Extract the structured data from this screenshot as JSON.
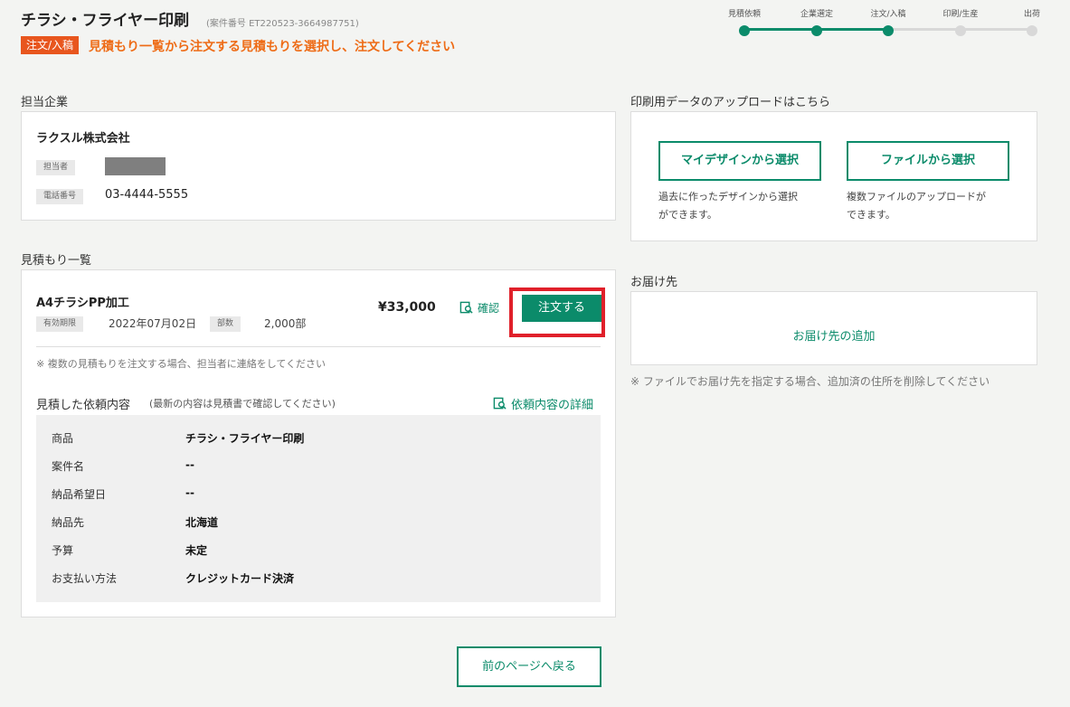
{
  "header": {
    "title": "チラシ・フライヤー印刷",
    "case_number": "(案件番号 ET220523-3664987751)",
    "status_badge": "注文/入稿",
    "instruction": "見積もり一覧から注文する見積もりを選択し、注文してください"
  },
  "stepper": {
    "steps": [
      {
        "label": "見積依頼",
        "state": "done"
      },
      {
        "label": "企業選定",
        "state": "done"
      },
      {
        "label": "注文/入稿",
        "state": "done"
      },
      {
        "label": "印刷/生産",
        "state": "todo"
      },
      {
        "label": "出荷",
        "state": "todo"
      }
    ]
  },
  "company": {
    "section_label": "担当企業",
    "name": "ラクスル株式会社",
    "contact_tag": "担当者",
    "phone_tag": "電話番号",
    "phone": "03-4444-5555"
  },
  "quotes": {
    "section_label": "見積もり一覧",
    "item": {
      "title": "A4チラシPP加工",
      "expiry_tag": "有効期限",
      "expiry": "2022年07月02日",
      "qty_tag": "部数",
      "qty": "2,000部",
      "price": "¥33,000",
      "confirm_label": "確認",
      "order_label": "注文する"
    },
    "multi_note": "※ 複数の見積もりを注文する場合、担当者に連絡をしてください",
    "request_heading": "見積した依頼内容",
    "request_note": "(最新の内容は見積書で確認してください)",
    "request_detail_link": "依頼内容の詳細",
    "details": [
      {
        "key": "商品",
        "value": "チラシ・フライヤー印刷"
      },
      {
        "key": "案件名",
        "value": "--"
      },
      {
        "key": "納品希望日",
        "value": "--"
      },
      {
        "key": "納品先",
        "value": "北海道"
      },
      {
        "key": "予算",
        "value": "未定"
      },
      {
        "key": "お支払い方法",
        "value": "クレジットカード決済"
      }
    ]
  },
  "upload": {
    "section_label": "印刷用データのアップロードはこちら",
    "design_button": "マイデザインから選択",
    "design_desc_1": "過去に作ったデザインから選択",
    "design_desc_2": "ができます。",
    "file_button": "ファイルから選択",
    "file_desc_1": "複数ファイルのアップロードが",
    "file_desc_2": "できます。"
  },
  "delivery": {
    "section_label": "お届け先",
    "add_label": "お届け先の追加",
    "note": "※ ファイルでお届け先を指定する場合、追加済の住所を削除してください"
  },
  "footer": {
    "back_label": "前のページへ戻る"
  },
  "colors": {
    "accent": "#0b8b6a",
    "badge": "#e8561e",
    "instruction": "#ee6c17",
    "highlight": "#e0202a"
  }
}
